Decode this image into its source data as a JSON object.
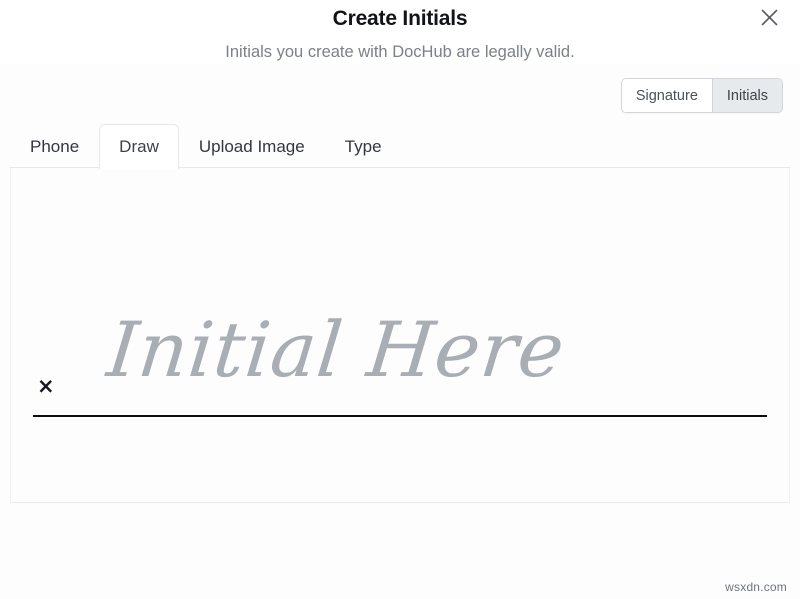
{
  "dialog": {
    "title": "Create Initials",
    "subtitle": "Initials you create with DocHub are legally valid.",
    "close_label": "×"
  },
  "mode_toggle": {
    "options": [
      "Signature",
      "Initials"
    ],
    "selected": "Initials"
  },
  "tabs": {
    "items": [
      "Phone",
      "Draw",
      "Upload Image",
      "Type"
    ],
    "active": "Draw"
  },
  "draw_area": {
    "placeholder_script": "Initial Here",
    "x_mark": "×",
    "script_color": "#a9adb4",
    "line_color": "#0c0d0f"
  },
  "watermark": {
    "text": "wsxdn.com"
  },
  "colors": {
    "title": "#111317",
    "subtitle": "#7b8189",
    "active_segment_bg": "#e7eaec",
    "border": "#e6e8ea",
    "page_bg": "#fdfdfe"
  }
}
